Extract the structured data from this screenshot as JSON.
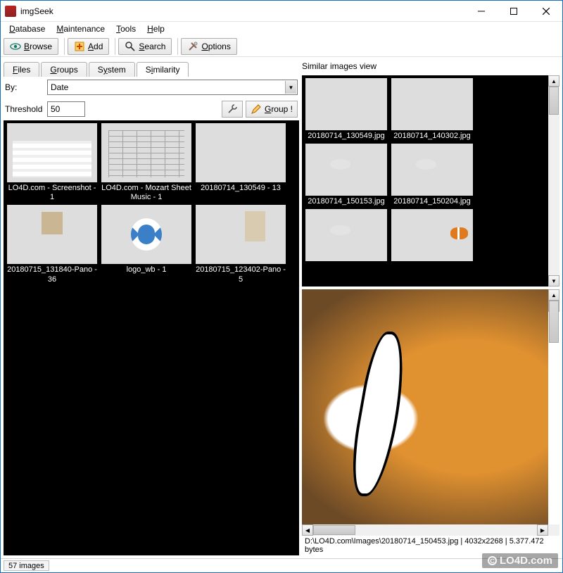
{
  "window": {
    "title": "imgSeek"
  },
  "menu": {
    "database": "Database",
    "maintenance": "Maintenance",
    "tools": "Tools",
    "help": "Help"
  },
  "toolbar": {
    "browse": "Browse",
    "add": "Add",
    "search": "Search",
    "options": "Options"
  },
  "tabs": {
    "files": "Files",
    "groups": "Groups",
    "system": "System",
    "similarity": "Similarity"
  },
  "by": {
    "label": "By:",
    "value": "Date"
  },
  "threshold": {
    "label": "Threshold",
    "value": "50",
    "group_btn": "Group !"
  },
  "left_thumbs": [
    {
      "caption": "LO4D.com - Screenshot - 1",
      "kind": "webpage"
    },
    {
      "caption": "LO4D.com - Mozart Sheet Music - 1",
      "kind": "sheet"
    },
    {
      "caption": "20180714_130549 - 13",
      "kind": "pano"
    },
    {
      "caption": "20180715_131840-Pano - 36",
      "kind": "tower"
    },
    {
      "caption": "logo_wb - 1",
      "kind": "logo"
    },
    {
      "caption": "20180715_123402-Pano - 5",
      "kind": "monument"
    }
  ],
  "similar": {
    "label": "Similar images view",
    "thumbs": [
      {
        "caption": "20180714_130549.jpg",
        "kind": "pano"
      },
      {
        "caption": "20180714_140302.jpg",
        "kind": "starfish"
      },
      {
        "caption": "20180714_150153.jpg",
        "kind": "aqua"
      },
      {
        "caption": "20180714_150204.jpg",
        "kind": "aqua"
      },
      {
        "caption": "",
        "kind": "aqua"
      },
      {
        "caption": "",
        "kind": "clown2"
      }
    ]
  },
  "preview": {
    "status": "D:\\LO4D.com\\Images\\20180714_150453.jpg | 4032x2268 | 5.377.472 bytes"
  },
  "statusbar": {
    "count": "57 images"
  },
  "watermark": "LO4D.com"
}
